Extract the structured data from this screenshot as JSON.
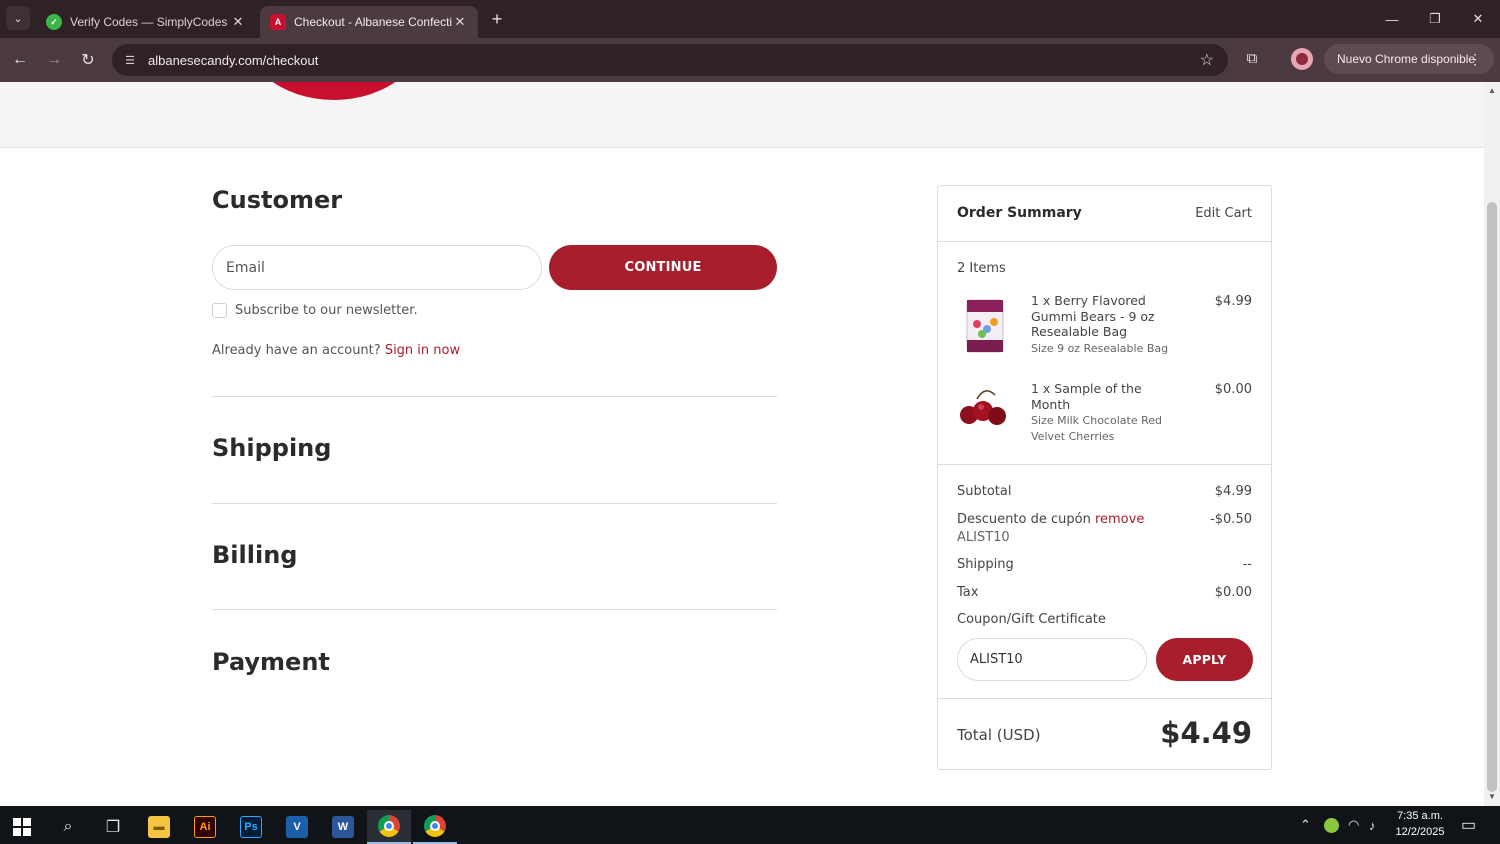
{
  "browser": {
    "tabs": [
      {
        "title": "Verify Codes — SimplyCodes",
        "active": false
      },
      {
        "title": "Checkout - Albanese Confection",
        "active": true
      }
    ],
    "url": "albanesecandy.com/checkout",
    "update_chip": "Nuevo Chrome disponible"
  },
  "checkout": {
    "customer_title": "Customer",
    "email_placeholder": "Email",
    "continue_label": "CONTINUE",
    "newsletter_label": "Subscribe to our newsletter.",
    "account_prompt": "Already have an account?",
    "sign_in_link": "Sign in now",
    "shipping_title": "Shipping",
    "billing_title": "Billing",
    "payment_title": "Payment"
  },
  "summary": {
    "title": "Order Summary",
    "edit_cart": "Edit Cart",
    "items_count": "2 Items",
    "items": [
      {
        "name": "1 x Berry Flavored Gummi Bears - 9 oz Resealable Bag",
        "size": "Size 9 oz Resealable Bag",
        "price": "$4.99"
      },
      {
        "name": "1 x Sample of the Month",
        "size": "Size Milk Chocolate Red Velvet Cherries",
        "price": "$0.00"
      }
    ],
    "subtotal_label": "Subtotal",
    "subtotal_value": "$4.99",
    "discount_label": "Descuento de cupón",
    "discount_remove": "remove",
    "discount_code": "ALIST10",
    "discount_value": "-$0.50",
    "shipping_label": "Shipping",
    "shipping_value": "--",
    "tax_label": "Tax",
    "tax_value": "$0.00",
    "coupon_link": "Coupon/Gift Certificate",
    "coupon_value": "ALIST10",
    "apply_label": "APPLY",
    "total_label": "Total (USD)",
    "total_value": "$4.49"
  },
  "taskbar": {
    "time": "7:35 a.m.",
    "date": "12/2/2025"
  },
  "colors": {
    "brand": "#a91e2c",
    "logo_red": "#c8102e",
    "chrome_dark": "#2f2226",
    "chrome_toolbar": "#4b3a3f"
  }
}
